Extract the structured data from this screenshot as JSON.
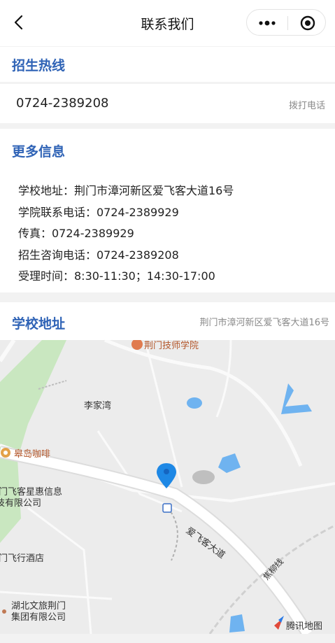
{
  "nav": {
    "title": "联系我们"
  },
  "hotline": {
    "heading": "招生热线",
    "phone": "0724-2389208",
    "call_label": "拨打电话"
  },
  "more_info": {
    "heading": "更多信息",
    "lines": [
      "学校地址：荆门市漳河新区爱飞客大道16号",
      "学院联系电话：0724-2389929",
      "传真：0724-2389929",
      "招生咨询电话：0724-2389208",
      "受理时间：8:30-11:30；14:30-17:00"
    ]
  },
  "address": {
    "heading": "学校地址",
    "text": "荆门市漳河新区爱飞客大道16号"
  },
  "map": {
    "labels": {
      "top_school": "荆门技师学院",
      "village": "李家湾",
      "cafe": "皋岛咖啡",
      "company1_a": "门飞客星惠信息",
      "company1_b": "技有限公司",
      "hotel": "门飞行酒店",
      "company2_a": "湖北文旅荆门",
      "company2_b": "集团有限公司",
      "road_main": "爱飞客大道",
      "road_rail": "焦柳线"
    },
    "brand": "腾讯地图",
    "colors": {
      "water": "#6fb3f0",
      "green": "#c9e7c0",
      "road": "#ffffff",
      "pin": "#1e88e5"
    }
  }
}
